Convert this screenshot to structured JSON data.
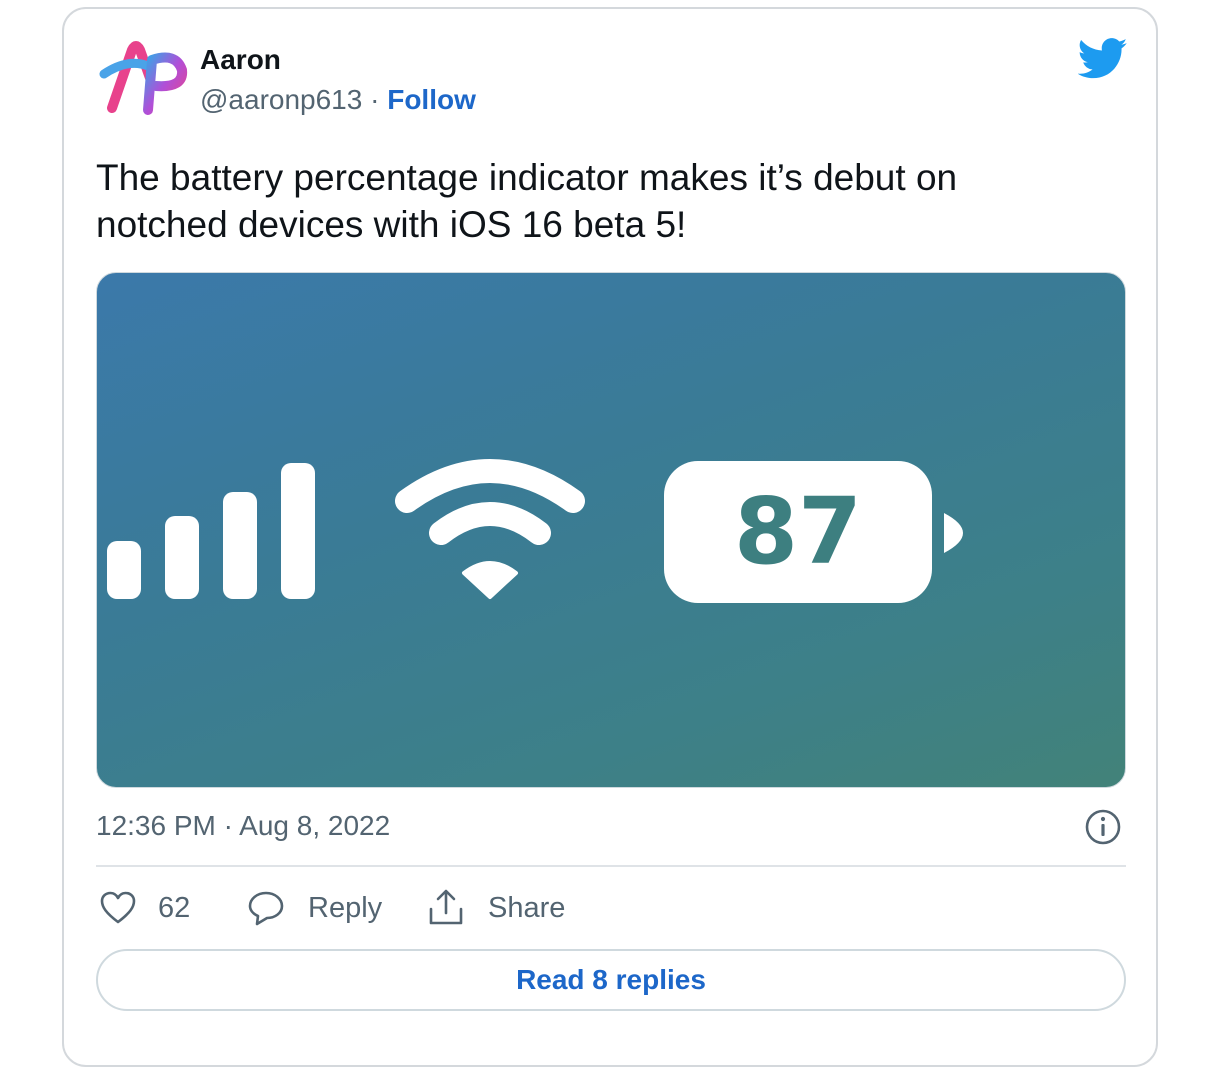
{
  "author": {
    "name": "Aaron",
    "handle": "@aaronp613",
    "separator": " · ",
    "follow_label": "Follow",
    "avatar_text": "AP"
  },
  "tweet": {
    "text": "The battery percentage indicator makes it’s debut on notched devices with iOS 16 beta 5!",
    "timestamp": "12:36 PM · Aug 8, 2022"
  },
  "media": {
    "battery_percentage": "87",
    "signal_icon": "cellular-signal-icon",
    "wifi_icon": "wifi-icon",
    "battery_icon": "battery-icon"
  },
  "actions": {
    "like_count": "62",
    "reply_label": "Reply",
    "share_label": "Share"
  },
  "footer": {
    "read_replies_label": "Read 8 replies"
  },
  "colors": {
    "link": "#1d67c9",
    "twitter_blue": "#1d9bf0",
    "muted_text": "#536471",
    "image_teal": "#3d7f80"
  }
}
